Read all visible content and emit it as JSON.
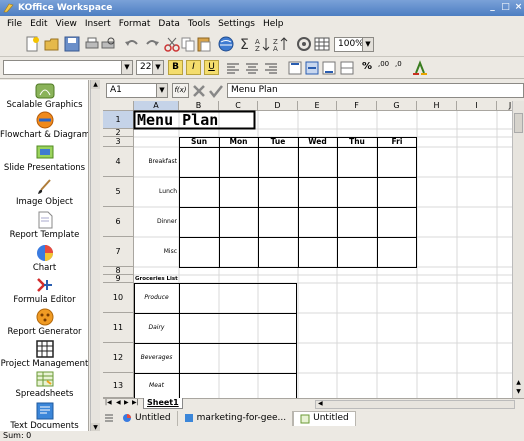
{
  "window": {
    "title": "KOffice Workspace"
  },
  "menu": [
    "File",
    "Edit",
    "View",
    "Insert",
    "Format",
    "Data",
    "Tools",
    "Settings",
    "Help"
  ],
  "toolbar": {
    "zoom": "100%",
    "font_size": "22",
    "font_name": "",
    "bold": "B",
    "italic": "I",
    "underline": "U",
    "percent": "%",
    "dec_inc": ",00",
    "dec_dec": ",0"
  },
  "sidebar": {
    "items": [
      "Scalable Graphics",
      "Flowchart & Diagram",
      "Slide Presentations",
      "Image Object",
      "Report Template",
      "Chart",
      "Formula Editor",
      "Report Generator",
      "Project Management",
      "Spreadsheets",
      "Text Documents"
    ]
  },
  "formula": {
    "cell_ref": "A1",
    "func_label": "f(x)",
    "content": "Menu Plan"
  },
  "sheet": {
    "columns": [
      "A",
      "B",
      "C",
      "D",
      "E",
      "F",
      "G",
      "H",
      "I",
      "J"
    ],
    "title": "Menu Plan",
    "days": [
      "Sun",
      "Mon",
      "Tue",
      "Wed",
      "Thu",
      "Fri"
    ],
    "meals": [
      "Breakfast",
      "Lunch",
      "Dinner",
      "Misc"
    ],
    "groceries_label": "Groceries List",
    "groceries": [
      "Produce",
      "Dairy",
      "Beverages",
      "Meat"
    ],
    "rows": [
      "1",
      "2",
      "3",
      "4",
      "5",
      "6",
      "7",
      "8",
      "9",
      "10",
      "11",
      "12",
      "13"
    ],
    "tab": "Sheet1"
  },
  "doc_tabs": [
    "Untitled",
    "marketing-for-gee...",
    "Untitled"
  ],
  "status": {
    "sum": "Sum: 0"
  },
  "colors": {
    "title_bar": "#4d7ec2",
    "selection": "#c5d3e8"
  }
}
